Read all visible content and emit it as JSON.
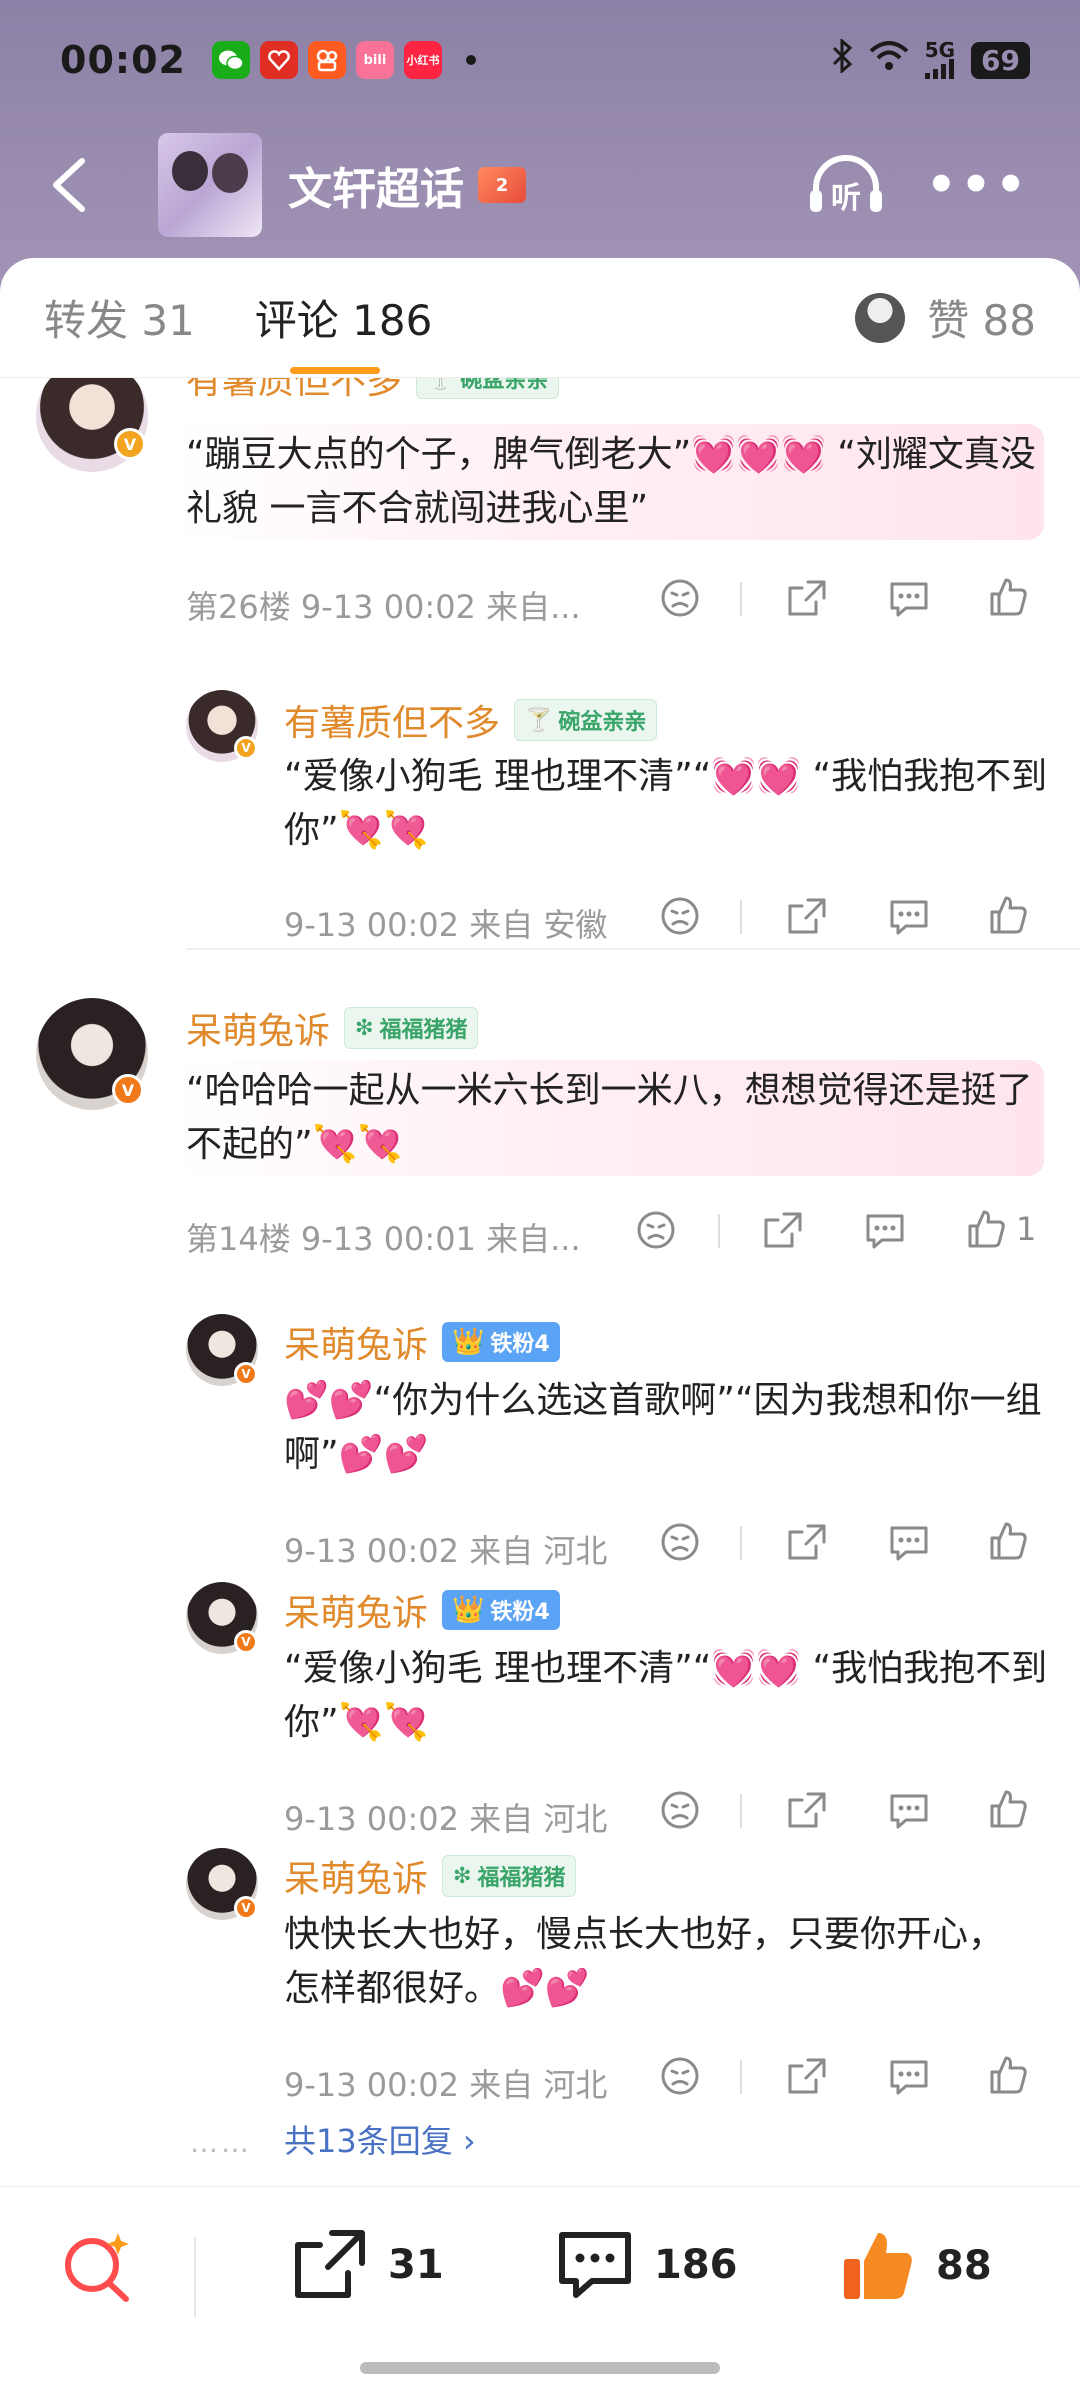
{
  "status_bar": {
    "time": "00:02",
    "battery": "69",
    "network": "5G"
  },
  "app_icons": [
    {
      "name": "wechat-icon",
      "label": "",
      "color": "#1aad19"
    },
    {
      "name": "pinduoduo-icon",
      "label": "",
      "color": "#e02e24"
    },
    {
      "name": "kuaishou-icon",
      "label": "",
      "color": "#ff5a1f"
    },
    {
      "name": "bilibili-icon",
      "label": "bili",
      "color": "#fb7299"
    },
    {
      "name": "xiaohongshu-icon",
      "label": "小红书",
      "color": "#ff2442"
    }
  ],
  "navbar": {
    "title": "文轩超话",
    "badge": "2",
    "listen_label": "听"
  },
  "tabs": {
    "repost": "转发 31",
    "comments": "评论 186",
    "likes": "赞 88"
  },
  "comments": [
    {
      "user": "有薯质但不多",
      "tag": "碗盆亲亲",
      "text": "“蹦豆大点的个子，脾气倒老大”💓💓💓 “刘耀文真没礼貌 一言不合就闯进我心里”",
      "meta": "第26楼  9-13 00:02  来自...",
      "replies": [
        {
          "user": "有薯质但不多",
          "tag": "碗盆亲亲",
          "text": "“爱像小狗毛 理也理不清”“💓💓 “我怕我抱不到你”💘💘",
          "meta": "9-13 00:02  来自 安徽"
        }
      ]
    },
    {
      "user": "呆萌兔诉",
      "tag": "福福猪猪",
      "text": "“哈哈哈一起从一米六长到一米八，想想觉得还是挺了不起的”💘💘",
      "meta": "第14楼  9-13 00:01  来自...",
      "like_count": "1",
      "replies": [
        {
          "user": "呆萌兔诉",
          "tag": "铁粉4",
          "text": "💕💕“你为什么选这首歌啊”“因为我想和你一组啊”💕💕",
          "meta": "9-13 00:02  来自 河北"
        },
        {
          "user": "呆萌兔诉",
          "tag": "铁粉4",
          "text": "“爱像小狗毛 理也理不清”“💓💓 “我怕我抱不到你”💘💘",
          "meta": "9-13 00:02  来自 河北"
        },
        {
          "user": "呆萌兔诉",
          "tag": "福福猪猪",
          "text": "快快长大也好，慢点长大也好，只要你开心，怎样都很好。💕💕",
          "meta": "9-13 00:02  来自 河北"
        }
      ],
      "more_replies": "共13条回复 ›",
      "more_dots": "……"
    }
  ],
  "bottom_bar": {
    "repost_count": "31",
    "comment_count": "186",
    "like_count": "88"
  },
  "colors": {
    "header": "#9a8db0",
    "username": "#e08a2c",
    "tab_indicator": "#ff9a1a",
    "link": "#4a72c4",
    "like_orange": "#f58a22"
  }
}
